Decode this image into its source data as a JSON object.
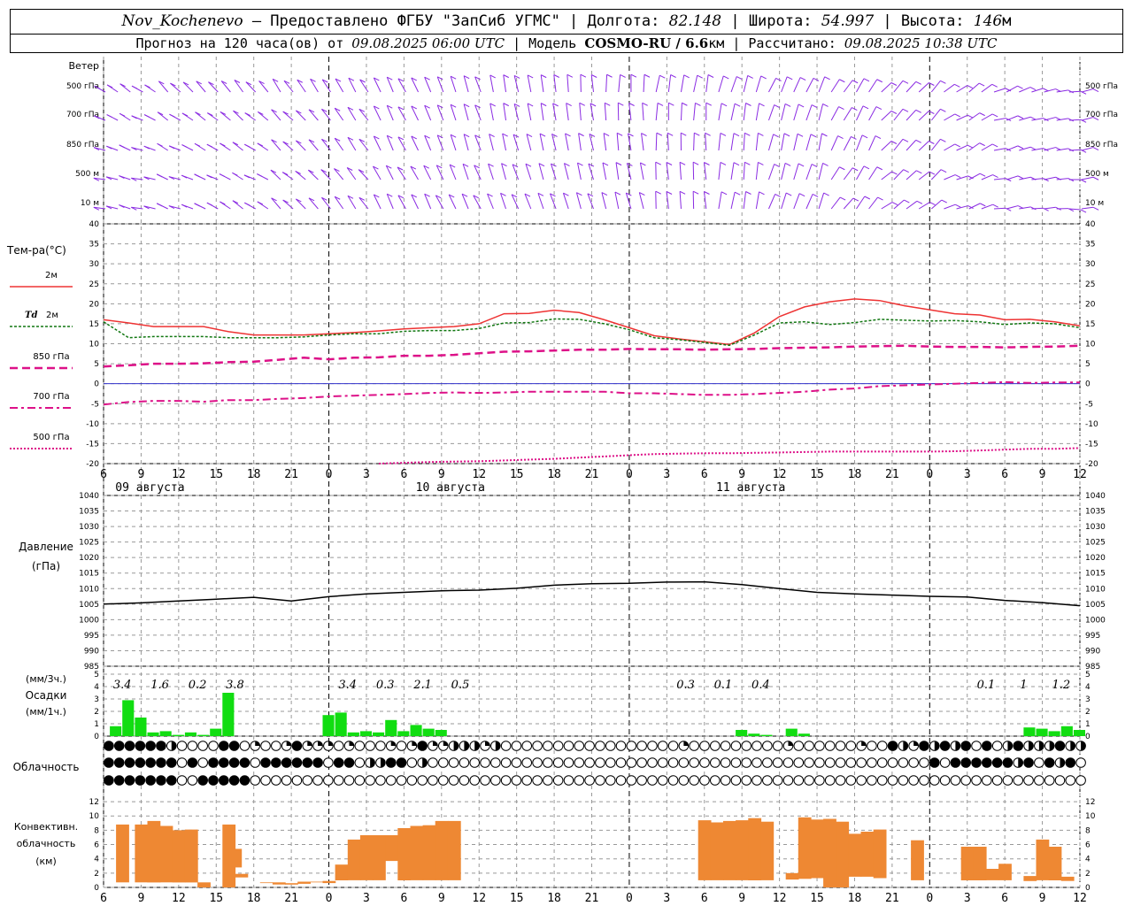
{
  "header": {
    "station": "Nov_Kochenevo",
    "provider": " – Предоставлено ФГБУ \"ЗапСиб УГМС\" | Долгота: ",
    "lon": "82.148",
    "lat_label": " | Широта: ",
    "lat": "54.997",
    "alt_label": " | Высота: ",
    "alt": "146",
    "alt_unit": "м",
    "forecast_text": "Прогноз на 120 часа(ов) от ",
    "start": "09.08.2025 06:00 UTC",
    "model_label": "  | Модель ",
    "model": "COSMO-RU / 6.6",
    "model_unit": "км",
    "calc_label": " | Рассчитано: ",
    "calc": "09.08.2025 10:38 UTC"
  },
  "colors": {
    "wind": "#8a2be2",
    "t2m": "#ee3333",
    "td2m": "#117711",
    "t850": "#dd1188",
    "t700": "#dd1188",
    "t500": "#dd1188",
    "precip": "#11dd11",
    "convective": "#ee8833",
    "pressure": "#000000",
    "grid": "#999999"
  },
  "panels": {
    "wind": {
      "title": "Ветер",
      "levels": [
        "500 гПа",
        "700 гПа",
        "850 гПа",
        "500 м",
        "10 м"
      ]
    },
    "temperature": {
      "title": "Тем-ра(°C)",
      "legend": [
        {
          "label": "2м",
          "style": "solid"
        },
        {
          "label_prefix": "Td",
          "label": "2м",
          "style": "dotted"
        },
        {
          "label": "850 гПа",
          "style": "dash"
        },
        {
          "label": "700 гПа",
          "style": "dashdot"
        },
        {
          "label": "500 гПа",
          "style": "dot"
        }
      ],
      "ylim": [
        -20,
        40
      ],
      "ticks": [
        40,
        35,
        30,
        25,
        20,
        15,
        10,
        5,
        0,
        -5,
        -10,
        -15,
        -20
      ]
    },
    "pressure": {
      "title": "Давление",
      "unit": "(гПа)",
      "ylim": [
        985,
        1040
      ],
      "ticks": [
        1040,
        1035,
        1030,
        1025,
        1020,
        1015,
        1010,
        1005,
        1000,
        995,
        990,
        985
      ]
    },
    "precip": {
      "unit_top": "(мм/3ч.)",
      "title": "Осадки",
      "unit_bottom": "(мм/1ч.)",
      "ylim": [
        0,
        5
      ],
      "ticks": [
        5,
        4,
        3,
        2,
        1,
        0
      ]
    },
    "cloud": {
      "title": "Облачность"
    },
    "convective": {
      "title_1": "Конвективн.",
      "title_2": "облачность",
      "unit": "(км)",
      "ylim": [
        0,
        13
      ],
      "ticks": [
        12,
        10,
        8,
        6,
        4,
        2,
        0
      ]
    }
  },
  "x_tick_labels": [
    "6",
    "9",
    "12",
    "15",
    "18",
    "21",
    "0",
    "3",
    "6",
    "9",
    "12",
    "15",
    "18",
    "21",
    "0",
    "3",
    "6",
    "9",
    "12",
    "15",
    "18",
    "21",
    "0",
    "3",
    "6",
    "9",
    "12"
  ],
  "date_labels": [
    {
      "text": "09 августа",
      "after_hours": 3
    },
    {
      "text": "10 августа",
      "after_hours": 27
    },
    {
      "text": "11 августа",
      "after_hours": 51
    }
  ],
  "chart_data": [
    {
      "type": "line",
      "panel": "temperature",
      "x_hours_from_start": [
        0,
        2,
        4,
        6,
        8,
        10,
        12,
        14,
        16,
        18,
        20,
        22,
        24,
        26,
        28,
        30,
        32,
        34,
        36,
        38,
        40,
        42,
        44,
        46,
        48,
        50,
        52,
        54,
        56,
        58,
        60,
        62,
        64,
        66,
        68,
        70,
        72,
        74,
        76,
        78
      ],
      "series": [
        {
          "name": "2м",
          "values": [
            16,
            15.2,
            14.3,
            14.3,
            14.3,
            13,
            12.2,
            12.2,
            12.2,
            12.5,
            12.8,
            13.2,
            13.7,
            14,
            14.3,
            15,
            17.5,
            17.6,
            18.4,
            17.8,
            16,
            14,
            12,
            11.2,
            10.5,
            9.8,
            12.7,
            16.8,
            19.2,
            20.5,
            21.2,
            20.8,
            19.5,
            18.5,
            17.5,
            17.2,
            16,
            16.1,
            15.5,
            14.5
          ]
        },
        {
          "name": "Td 2м",
          "values": [
            15.5,
            11.5,
            11.8,
            11.8,
            11.8,
            11.5,
            11.5,
            11.5,
            11.7,
            12.2,
            12.5,
            12.5,
            13.1,
            13.3,
            13.3,
            13.8,
            15.2,
            15.3,
            16.2,
            16.1,
            15,
            13.5,
            11.5,
            11,
            10.3,
            9.6,
            12.2,
            15.2,
            15.5,
            14.8,
            15.3,
            16.1,
            15.9,
            15.7,
            15.8,
            15.5,
            14.8,
            15.2,
            15,
            14
          ]
        },
        {
          "name": "850 гПа",
          "values": [
            4.3,
            4.6,
            5,
            5,
            5.1,
            5.4,
            5.5,
            6,
            6.5,
            6.1,
            6.5,
            6.6,
            7,
            7,
            7.2,
            7.6,
            8,
            8.1,
            8.3,
            8.5,
            8.5,
            8.7,
            8.6,
            8.6,
            8.5,
            8.6,
            8.7,
            8.9,
            9,
            9.1,
            9.3,
            9.4,
            9.5,
            9.3,
            9.2,
            9.2,
            9.1,
            9.2,
            9.3,
            9.5
          ]
        },
        {
          "name": "700 гПа",
          "values": [
            -5.2,
            -4.6,
            -4.3,
            -4.3,
            -4.5,
            -4.1,
            -4.1,
            -3.8,
            -3.6,
            -3.2,
            -3,
            -2.8,
            -2.6,
            -2.3,
            -2.2,
            -2.3,
            -2.2,
            -2,
            -2,
            -2,
            -2,
            -2.4,
            -2.4,
            -2.6,
            -2.8,
            -2.8,
            -2.6,
            -2.3,
            -2,
            -1.5,
            -1.2,
            -0.6,
            -0.4,
            -0.2,
            0,
            0.2,
            0.4,
            0.2,
            0.3,
            0.3
          ]
        },
        {
          "name": "500 гПа",
          "values": [
            null,
            null,
            null,
            null,
            null,
            null,
            null,
            null,
            null,
            null,
            null,
            -20,
            -19.8,
            -19.6,
            -19.5,
            -19.4,
            -19.2,
            -19,
            -18.8,
            -18.5,
            -18.2,
            -17.9,
            -17.6,
            -17.5,
            -17.4,
            -17.4,
            -17.3,
            -17.2,
            -17.1,
            -17,
            -17,
            -17,
            -17,
            -17,
            -16.9,
            -16.7,
            -16.5,
            -16.3,
            -16.3,
            -16.1
          ]
        }
      ]
    },
    {
      "type": "line",
      "panel": "pressure",
      "name": "Давление",
      "x_hours_from_start": [
        0,
        3,
        6,
        9,
        12,
        15,
        18,
        21,
        24,
        27,
        30,
        33,
        36,
        39,
        42,
        45,
        48,
        51,
        54,
        57,
        60,
        63,
        66,
        69,
        72,
        75,
        78
      ],
      "values": [
        1005,
        1005.4,
        1006,
        1006.6,
        1007.2,
        1006,
        1007.4,
        1008.3,
        1008.8,
        1009.3,
        1009.5,
        1010.1,
        1011.1,
        1011.6,
        1011.7,
        1012.1,
        1012.2,
        1011.3,
        1010,
        1008.8,
        1008.3,
        1007.9,
        1007.5,
        1007.3,
        1006.2,
        1005.5,
        1004.5
      ]
    },
    {
      "type": "bar",
      "panel": "precip",
      "name": "Осадки мм/1ч",
      "x_hours_from_start": [
        1,
        2,
        3,
        4,
        5,
        6,
        7,
        8,
        9,
        10,
        11,
        18,
        19,
        20,
        21,
        22,
        23,
        24,
        25,
        26,
        27,
        28,
        29,
        30,
        31,
        32,
        33,
        34,
        35,
        36,
        37,
        38,
        39,
        40,
        41,
        42,
        43,
        44,
        45,
        46,
        47,
        48,
        49,
        50,
        51,
        52,
        53,
        54,
        55,
        56,
        57,
        58,
        59,
        60,
        61,
        62,
        63,
        64,
        65,
        66,
        67,
        68,
        69,
        70,
        71,
        72,
        73,
        74,
        75,
        76,
        77,
        78
      ],
      "values": [
        0.8,
        2.9,
        1.5,
        0.3,
        0.4,
        0.1,
        0.3,
        0.1,
        0.6,
        3.5,
        0,
        1.7,
        1.9,
        0.3,
        0.4,
        0.3,
        1.3,
        0.4,
        0.9,
        0.6,
        0.5,
        0,
        0,
        0,
        0,
        0,
        0,
        0,
        0,
        0,
        0,
        0,
        0,
        0,
        0,
        0,
        0,
        0,
        0,
        0,
        0,
        0,
        0,
        0,
        0,
        0,
        0,
        0,
        0,
        0,
        0,
        0,
        0,
        0,
        0,
        0,
        0,
        0,
        0,
        0,
        0,
        0,
        0,
        0,
        0,
        0,
        0,
        0.7,
        0.6,
        0.4,
        0.8,
        0.5
      ],
      "x_extra": [
        48,
        49,
        50,
        51,
        52,
        53,
        54,
        55,
        56,
        57,
        58,
        59
      ],
      "values_extra": [
        0,
        0,
        0,
        0.5,
        0.2,
        0.1,
        0,
        0.6,
        0.2,
        0,
        0,
        0
      ]
    },
    {
      "type": "table",
      "panel": "precip_3h_labels",
      "x_hours_from_start": [
        1.5,
        4.5,
        7.5,
        10.5,
        19.5,
        22.5,
        25.5,
        28.5,
        46.5,
        49.5,
        52.5,
        70.5,
        73.5,
        76.5
      ],
      "values": [
        "3.4",
        "1.6",
        "0.2",
        "3.8",
        "3.4",
        "0.3",
        "2.1",
        "0.5",
        "0.3",
        "0.1",
        "0.4",
        "0.1",
        "1",
        "1.2"
      ]
    },
    {
      "type": "bar",
      "panel": "convective",
      "name": "Конвективная облачность (км)",
      "x_hours_from_start": [
        1.5,
        3,
        4,
        5,
        6,
        7,
        8,
        10,
        10.5,
        11,
        12,
        13,
        14,
        15,
        16,
        17,
        18,
        19,
        20,
        21,
        22,
        23,
        24,
        25,
        26,
        27,
        28,
        48,
        49,
        50,
        51,
        52,
        53,
        54,
        55,
        56,
        57,
        58,
        59,
        60,
        61,
        62,
        63,
        65,
        69,
        70,
        71,
        72,
        74,
        75,
        76,
        77
      ],
      "values_base": [
        0.7,
        0.7,
        0.7,
        0.7,
        0.7,
        0.7,
        0,
        0,
        2.8,
        1.4,
        0.9,
        0.6,
        0.4,
        0.4,
        0.5,
        0.7,
        0.6,
        1,
        1,
        1,
        1,
        3.7,
        1,
        1,
        1,
        1,
        1,
        1,
        1,
        1,
        1,
        1,
        1,
        1.1,
        1.1,
        1.2,
        1.3,
        0,
        0,
        1.5,
        1.5,
        1.3,
        1.2,
        1,
        1,
        1,
        1,
        1,
        0.9,
        1,
        1,
        0.9
      ],
      "values_top": [
        8.8,
        8.8,
        9.3,
        8.6,
        8,
        8.1,
        0.7,
        8.8,
        5.4,
        1.9,
        0.9,
        0.7,
        0.7,
        0.6,
        0.8,
        0.8,
        0.9,
        3.2,
        6.7,
        7.3,
        7.3,
        7.3,
        8.3,
        8.6,
        8.7,
        9.3,
        9.3,
        9.4,
        9.1,
        9.3,
        9.4,
        9.7,
        9.2,
        1,
        2,
        9.8,
        9.5,
        9.6,
        9.2,
        7.5,
        7.8,
        8.1,
        0.6,
        6.6,
        5.7,
        5.7,
        2.6,
        3.3,
        1.6,
        6.7,
        5.7,
        1.5
      ]
    }
  ],
  "cloud_rows": [
    "3333332000033010013111010001013112221200000000000000000100000000010000001003213232303023222322",
    "3333333030333303333330330223302000000000000000000000000000000000000000000000000303333332303230",
    "3333333003333300000000000000000000000000000000000000000000000000000000000000000000000000000000"
  ]
}
